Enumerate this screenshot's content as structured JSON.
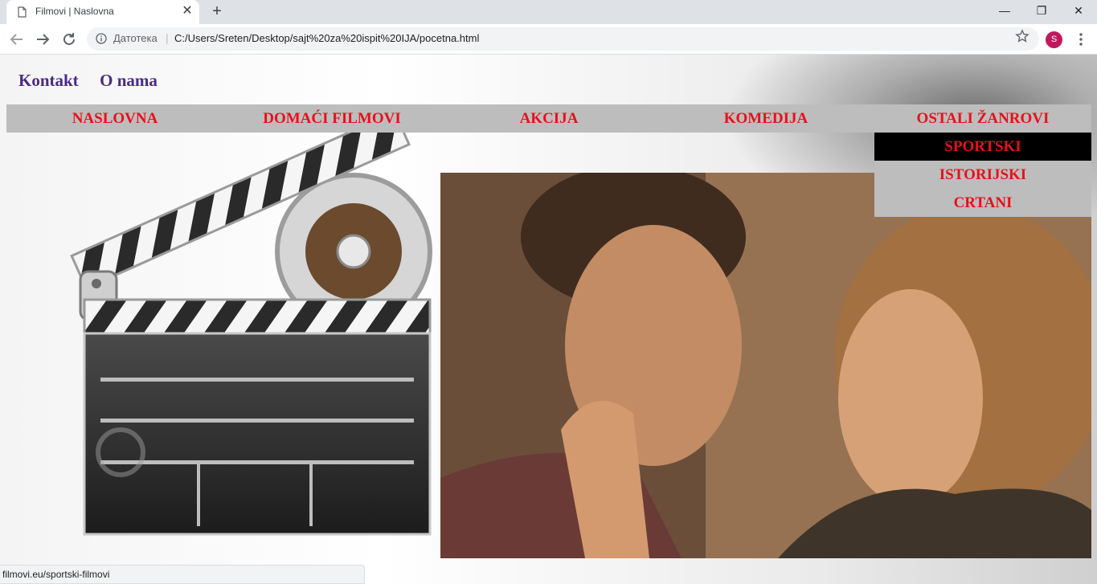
{
  "browser": {
    "tab_title": "Filmovi | Naslovna",
    "tab_close": "✕",
    "new_tab": "+",
    "scheme_label": "Датотека",
    "url": "C:/Users/Sreten/Desktop/sajt%20za%20ispit%20IJA/pocetna.html",
    "profile_initial": "S",
    "window_controls": [
      "—",
      "❐",
      "✕"
    ],
    "status_url": "filmovi.eu/sportski-filmovi"
  },
  "top_links": [
    {
      "label": "Kontakt"
    },
    {
      "label": "O nama"
    }
  ],
  "nav": {
    "items": [
      {
        "label": "NASLOVNA"
      },
      {
        "label": "DOMAĆI FILMOVI"
      },
      {
        "label": "AKCIJA"
      },
      {
        "label": "KOMEDIJA"
      },
      {
        "label": "OSTALI ŽANROVI"
      }
    ],
    "dropdown": [
      {
        "label": "SPORTSKI",
        "hovered": true
      },
      {
        "label": "ISTORIJSKI",
        "hovered": false
      },
      {
        "label": "CRTANI",
        "hovered": false
      }
    ]
  },
  "colors": {
    "nav_text": "#e8101a",
    "top_link": "#4b2a86",
    "nav_bg": "#bdbdbd",
    "hover_bg": "#000000"
  }
}
